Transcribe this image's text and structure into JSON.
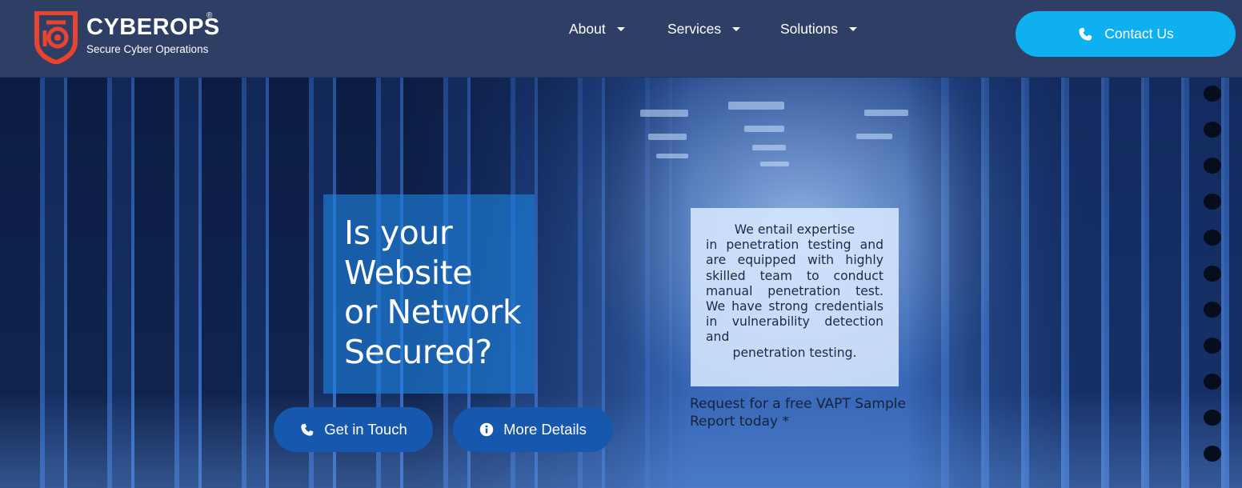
{
  "brand": {
    "name": "CYBEROPS",
    "registered": "®",
    "tagline": "Secure Cyber Operations",
    "logo_icon": "cyberops-shield-logo"
  },
  "nav": {
    "items": [
      {
        "label": "About",
        "icon": "caret-down-icon"
      },
      {
        "label": "Services",
        "icon": "caret-down-icon"
      },
      {
        "label": "Solutions",
        "icon": "caret-down-icon"
      }
    ]
  },
  "contact_button": {
    "label": "Contact Us",
    "icon": "phone-icon"
  },
  "hero": {
    "headline_lines": [
      "Is your",
      "Website",
      "or Network",
      "Secured?"
    ],
    "buttons": [
      {
        "label": "Get in Touch",
        "icon": "phone-icon"
      },
      {
        "label": "More Details",
        "icon": "info-icon"
      }
    ],
    "info_card": {
      "first_line": "We entail expertise",
      "body": "in penetration testing and are equipped with highly skilled team to conduct manual penetration test. We have strong credentials in vulnerability detection and",
      "last_line": "penetration testing."
    },
    "vapt_request": "Request for a free VAPT Sample Report today *"
  },
  "colors": {
    "header_bg": "#2f3e64",
    "contact_button_bg": "#0fb0ef",
    "hero_button_bg": "#1658ad",
    "logo_accent": "#e8442f",
    "headline_box_bg": "#1e82e1"
  }
}
